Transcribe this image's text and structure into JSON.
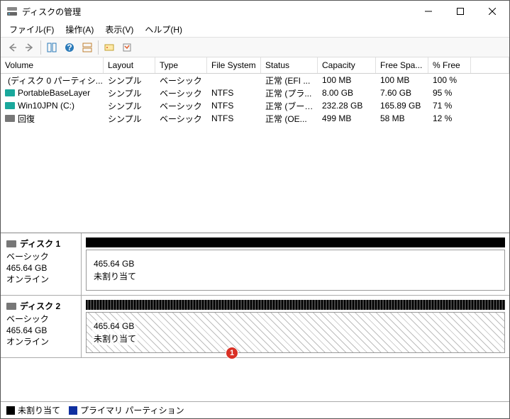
{
  "window": {
    "title": "ディスクの管理"
  },
  "menu": {
    "file": "ファイル(F)",
    "action": "操作(A)",
    "view": "表示(V)",
    "help": "ヘルプ(H)"
  },
  "volTable": {
    "headers": {
      "vol": "Volume",
      "lay": "Layout",
      "typ": "Type",
      "fs": "File System",
      "st": "Status",
      "cap": "Capacity",
      "fr": "Free Spa...",
      "pf": "% Free"
    },
    "rows": [
      {
        "icon": "gray",
        "vol": "(ディスク 0 パーティシ...",
        "lay": "シンプル",
        "typ": "ベーシック",
        "fs": "",
        "st": "正常 (EFI ...",
        "cap": "100 MB",
        "fr": "100 MB",
        "pf": "100 %"
      },
      {
        "icon": "teal",
        "vol": "PortableBaseLayer",
        "lay": "シンプル",
        "typ": "ベーシック",
        "fs": "NTFS",
        "st": "正常 (プラ...",
        "cap": "8.00 GB",
        "fr": "7.60 GB",
        "pf": "95 %"
      },
      {
        "icon": "teal",
        "vol": "Win10JPN (C:)",
        "lay": "シンプル",
        "typ": "ベーシック",
        "fs": "NTFS",
        "st": "正常 (ブート...",
        "cap": "232.28 GB",
        "fr": "165.89 GB",
        "pf": "71 %"
      },
      {
        "icon": "gray",
        "vol": "回復",
        "lay": "シンプル",
        "typ": "ベーシック",
        "fs": "NTFS",
        "st": "正常 (OE...",
        "cap": "499 MB",
        "fr": "58 MB",
        "pf": "12 %"
      }
    ]
  },
  "disks": [
    {
      "name": "ディスク 1",
      "type": "ベーシック",
      "size": "465.64 GB",
      "status": "オンライン",
      "part_size": "465.64 GB",
      "part_label": "未割り当て",
      "selected": false
    },
    {
      "name": "ディスク 2",
      "type": "ベーシック",
      "size": "465.64 GB",
      "status": "オンライン",
      "part_size": "465.64 GB",
      "part_label": "未割り当て",
      "selected": true
    }
  ],
  "legend": {
    "unalloc": "未割り当て",
    "primary": "プライマリ パーティション"
  },
  "annotation": {
    "badge1": "1"
  }
}
